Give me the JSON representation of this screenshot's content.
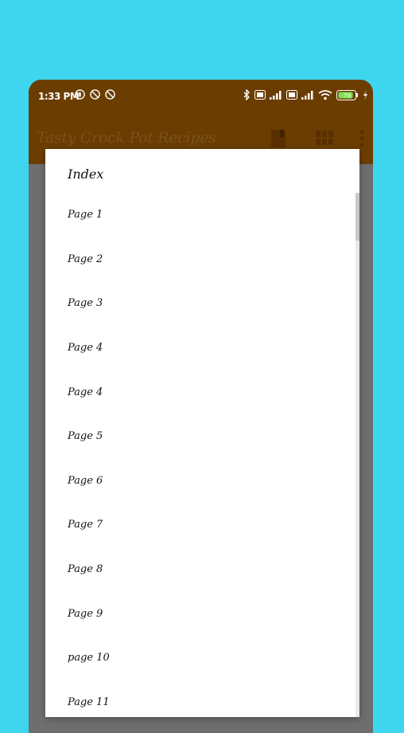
{
  "status": {
    "time": "1:33 PM",
    "battery": "79",
    "left_icons": [
      "fire-icon",
      "no-entry-icon",
      "no-entry-icon"
    ],
    "right_icons": [
      "bluetooth-icon",
      "volte-icon",
      "signal-icon",
      "volte-icon",
      "signal-icon",
      "wifi-icon",
      "battery-icon",
      "charging-icon"
    ]
  },
  "appbar": {
    "title": "Tasty Crock Pot Recipes",
    "icons": [
      "book-icon",
      "grid-icon",
      "more-vert-icon"
    ]
  },
  "dialog": {
    "title": "Index",
    "items": [
      "Page 1",
      "Page 2",
      "Page 3",
      "Page 4",
      "Page 4",
      "Page 5",
      "Page 6",
      "Page 7",
      "Page 8",
      "Page 9",
      "page 10",
      "Page 11"
    ]
  },
  "colors": {
    "background": "#3dd6ee",
    "appbar": "#6b3d00",
    "dim": "#6e6e6e",
    "dialog": "#ffffff"
  }
}
